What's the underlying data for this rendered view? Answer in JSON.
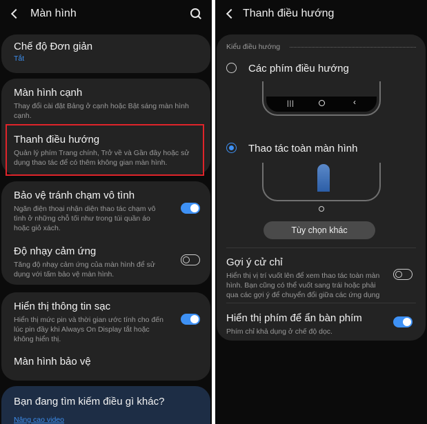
{
  "left": {
    "title": "Màn hình",
    "simple_mode": {
      "label": "Chế độ Đơn giản",
      "status": "Tắt"
    },
    "edge_screen": {
      "label": "Màn hình cạnh",
      "desc": "Thay đổi cài đặt Bảng ở cạnh hoặc Bật sáng màn hình cạnh."
    },
    "nav_bar": {
      "label": "Thanh điều hướng",
      "desc": "Quản lý phím Trang chính, Trở về và Gần đây hoặc sử dụng thao tác để có thêm không gian màn hình."
    },
    "accidental_touch": {
      "label": "Bảo vệ tránh chạm vô tình",
      "desc": "Ngăn điện thoại nhận diện thao tác chạm vô tình ở những chỗ tối như trong túi quần áo hoặc giỏ xách.",
      "on": true
    },
    "touch_sensitivity": {
      "label": "Độ nhạy cảm ứng",
      "desc": "Tăng độ nhạy cảm ứng của màn hình để sử dụng với tấm bảo vệ màn hình.",
      "on": false
    },
    "charging_info": {
      "label": "Hiển thị thông tin sạc",
      "desc": "Hiển thị mức pin và thời gian ước tính cho đến lúc pin đầy khi Always On Display tắt hoặc không hiển thị.",
      "on": true
    },
    "screensaver": {
      "label": "Màn hình bảo vệ"
    },
    "search_card": {
      "label": "Bạn đang tìm kiếm điều gì khác?",
      "link": "Nâng cao video"
    }
  },
  "right": {
    "title": "Thanh điều hướng",
    "section_label": "Kiểu điều hướng",
    "option_buttons": {
      "label": "Các phím điều hướng",
      "selected": false,
      "icons": [
        "recents-icon",
        "home-icon",
        "back-icon"
      ]
    },
    "option_gestures": {
      "label": "Thao tác toàn màn hình",
      "selected": true
    },
    "more_options_button": "Tùy chọn khác",
    "gesture_hints": {
      "label": "Gợi ý cử chỉ",
      "desc": "Hiển thị vị trí vuốt lên để xem thao tác toàn màn hình. Bạn cũng có thể vuốt sang trái hoặc phải qua các gợi ý để chuyển đổi giữa các ứng dụng",
      "on": false
    },
    "hide_keyboard_button": {
      "label": "Hiển thị phím để ẩn bàn phím",
      "desc": "Phím chỉ khả dụng ở chế độ dọc.",
      "on": true
    }
  },
  "colors": {
    "accent": "#3e91f5",
    "highlight": "#e0242a",
    "card": "#232323",
    "background": "#0b0b0b"
  }
}
